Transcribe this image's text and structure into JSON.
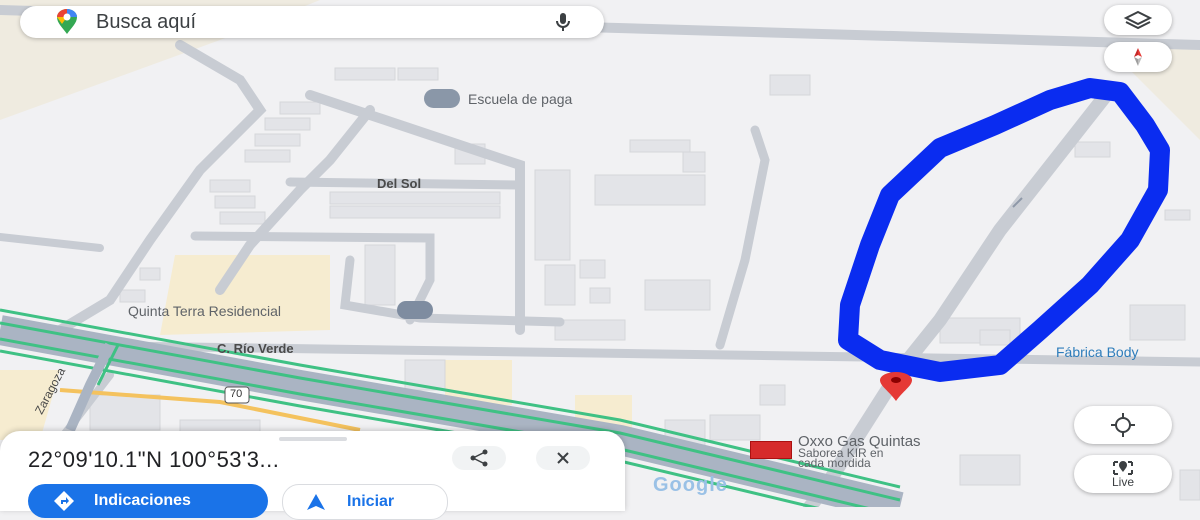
{
  "search": {
    "placeholder": "Busca aquí"
  },
  "map": {
    "labels": {
      "school": "Escuela de paga",
      "street_del_sol": "Del Sol",
      "residential": "Quinta Terra Residencial",
      "street_rio_verde": "C. Río Verde",
      "factory": "Fábrica Body",
      "street_zaragoza": "Zaragoza",
      "highway_shield": "70",
      "store_name": "Oxxo Gas Quintas",
      "store_sub1": "Saborea KIR en",
      "store_sub2": "cada mordida",
      "google_logo": "Google"
    },
    "annotation_color": "#0a2cf0",
    "pin_color": "#e53935"
  },
  "controls": {
    "live_label": "Live"
  },
  "sheet": {
    "coordinates": "22°09'10.1\"N 100°53'3...",
    "directions_label": "Indicaciones",
    "start_label": "Iniciar"
  }
}
